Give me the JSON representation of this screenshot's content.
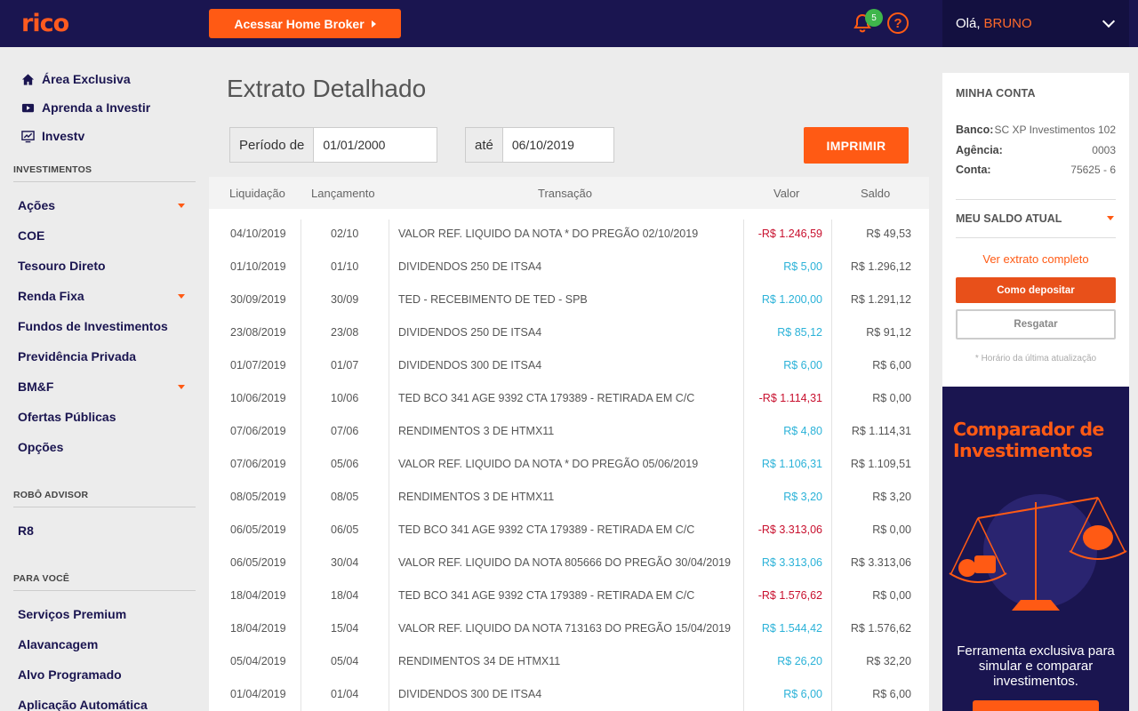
{
  "header": {
    "logo": "rico",
    "home_broker_label": "Acessar Home Broker",
    "notifications_count": "5",
    "help_label": "?",
    "greeting": "Olá,",
    "user_name": "BRUNO"
  },
  "sidebar": {
    "top_links": [
      {
        "label": "Área Exclusiva",
        "icon": "home-icon"
      },
      {
        "label": "Aprenda a Investir",
        "icon": "video-icon"
      },
      {
        "label": "Investv",
        "icon": "chart-monitor-icon"
      }
    ],
    "sections": [
      {
        "title": "INVESTIMENTOS",
        "items": [
          "Ações",
          "COE",
          "Tesouro Direto",
          "Renda Fixa",
          "Fundos de Investimentos",
          "Previdência Privada",
          "BM&F",
          "Ofertas Públicas",
          "Opções"
        ]
      },
      {
        "title": "ROBÔ ADVISOR",
        "items": [
          "R8"
        ]
      },
      {
        "title": "PARA VOCÊ",
        "items": [
          "Serviços Premium",
          "Alavancagem",
          "Alvo Programado",
          "Aplicação Automática"
        ]
      }
    ]
  },
  "main": {
    "title": "Extrato Detalhado",
    "filter": {
      "from_label": "Período de",
      "from_value": "01/01/2000",
      "to_label": "até",
      "to_value": "06/10/2019"
    },
    "print_label": "IMPRIMIR",
    "columns": [
      "Liquidação",
      "Lançamento",
      "Transação",
      "Valor",
      "Saldo"
    ],
    "rows": [
      {
        "liq": "04/10/2019",
        "lan": "02/10",
        "tra": "VALOR REF. LIQUIDO DA NOTA * DO PREGÃO 02/10/2019",
        "val": "-R$ 1.246,59",
        "sal": "R$ 49,53",
        "neg": true
      },
      {
        "liq": "01/10/2019",
        "lan": "01/10",
        "tra": "DIVIDENDOS 250 DE ITSA4",
        "val": "R$ 5,00",
        "sal": "R$ 1.296,12",
        "neg": false
      },
      {
        "liq": "30/09/2019",
        "lan": "30/09",
        "tra": "TED - RECEBIMENTO DE TED - SPB",
        "val": "R$ 1.200,00",
        "sal": "R$ 1.291,12",
        "neg": false
      },
      {
        "liq": "23/08/2019",
        "lan": "23/08",
        "tra": "DIVIDENDOS 250 DE ITSA4",
        "val": "R$ 85,12",
        "sal": "R$ 91,12",
        "neg": false
      },
      {
        "liq": "01/07/2019",
        "lan": "01/07",
        "tra": "DIVIDENDOS 300 DE ITSA4",
        "val": "R$ 6,00",
        "sal": "R$ 6,00",
        "neg": false
      },
      {
        "liq": "10/06/2019",
        "lan": "10/06",
        "tra": "TED BCO 341 AGE 9392 CTA 179389 - RETIRADA EM C/C",
        "val": "-R$ 1.114,31",
        "sal": "R$ 0,00",
        "neg": true
      },
      {
        "liq": "07/06/2019",
        "lan": "07/06",
        "tra": "RENDIMENTOS 3 DE HTMX11",
        "val": "R$ 4,80",
        "sal": "R$ 1.114,31",
        "neg": false
      },
      {
        "liq": "07/06/2019",
        "lan": "05/06",
        "tra": "VALOR REF. LIQUIDO DA NOTA * DO PREGÃO 05/06/2019",
        "val": "R$ 1.106,31",
        "sal": "R$ 1.109,51",
        "neg": false
      },
      {
        "liq": "08/05/2019",
        "lan": "08/05",
        "tra": "RENDIMENTOS 3 DE HTMX11",
        "val": "R$ 3,20",
        "sal": "R$ 3,20",
        "neg": false
      },
      {
        "liq": "06/05/2019",
        "lan": "06/05",
        "tra": "TED BCO 341 AGE 9392 CTA 179389 - RETIRADA EM C/C",
        "val": "-R$ 3.313,06",
        "sal": "R$ 0,00",
        "neg": true
      },
      {
        "liq": "06/05/2019",
        "lan": "30/04",
        "tra": "VALOR REF. LIQUIDO DA NOTA 805666 DO PREGÃO 30/04/2019",
        "val": "R$ 3.313,06",
        "sal": "R$ 3.313,06",
        "neg": false
      },
      {
        "liq": "18/04/2019",
        "lan": "18/04",
        "tra": "TED BCO 341 AGE 9392 CTA 179389 - RETIRADA EM C/C",
        "val": "-R$ 1.576,62",
        "sal": "R$ 0,00",
        "neg": true
      },
      {
        "liq": "18/04/2019",
        "lan": "15/04",
        "tra": "VALOR REF. LIQUIDO DA NOTA 713163 DO PREGÃO 15/04/2019",
        "val": "R$ 1.544,42",
        "sal": "R$ 1.576,62",
        "neg": false
      },
      {
        "liq": "05/04/2019",
        "lan": "05/04",
        "tra": "RENDIMENTOS 34 DE HTMX11",
        "val": "R$ 26,20",
        "sal": "R$ 32,20",
        "neg": false
      },
      {
        "liq": "01/04/2019",
        "lan": "01/04",
        "tra": "DIVIDENDOS 300 DE ITSA4",
        "val": "R$ 6,00",
        "sal": "R$ 6,00",
        "neg": false
      }
    ]
  },
  "account": {
    "title": "MINHA CONTA",
    "bank_label": "Banco:",
    "bank_value": "SC XP Investimentos 102",
    "agency_label": "Agência:",
    "agency_value": "0003",
    "account_label": "Conta:",
    "account_value": "75625 - 6",
    "balance_title": "MEU SALDO ATUAL",
    "full_statement_link": "Ver extrato completo",
    "deposit_label": "Como depositar",
    "withdraw_label": "Resgatar",
    "update_note": "* Horário da última atualização"
  },
  "promo": {
    "title": "Comparador de Investimentos",
    "text": "Ferramenta exclusiva para simular e comparar investimentos."
  },
  "colors": {
    "brand_navy": "#1a1550",
    "brand_orange": "#ff5a14",
    "negative": "#c8102e",
    "positive": "#2bb2d8"
  }
}
